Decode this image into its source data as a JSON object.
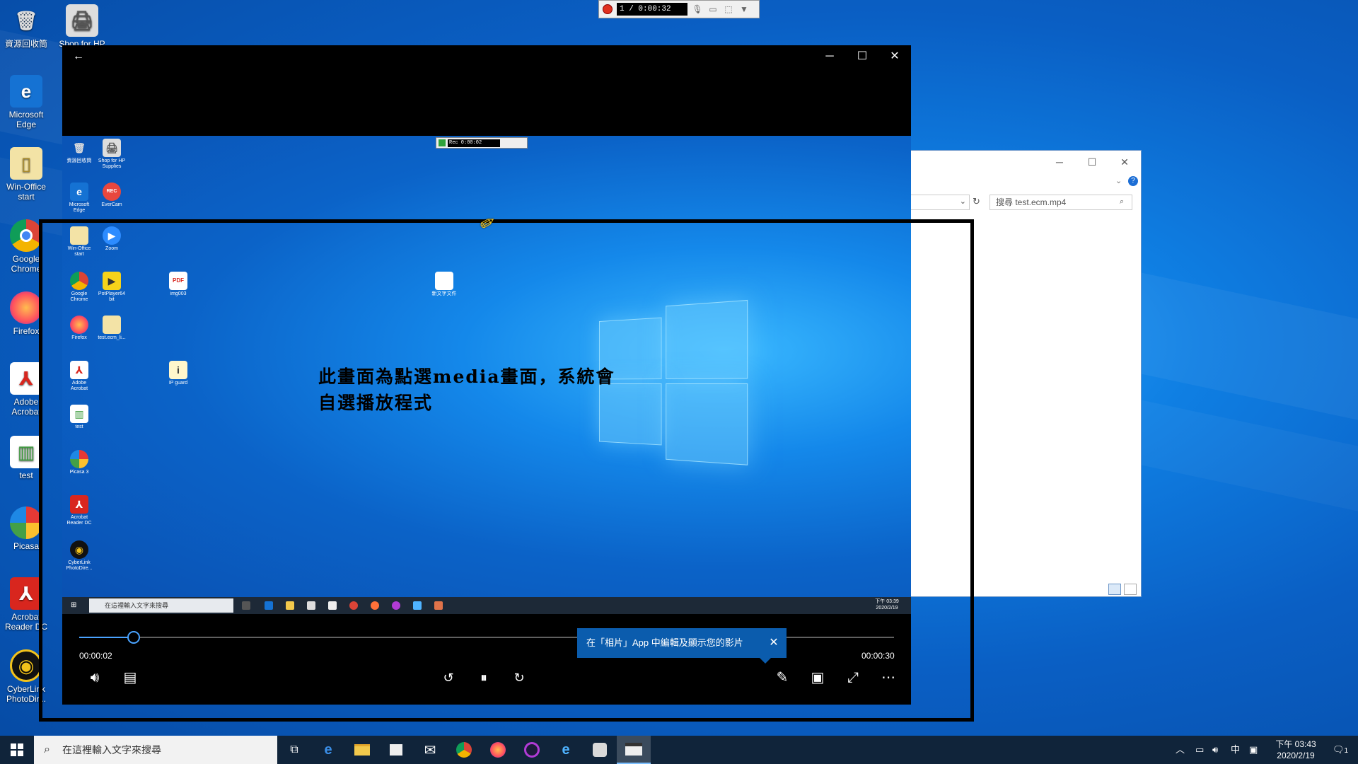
{
  "desktop": {
    "icons": [
      {
        "label": "資源回收筒",
        "icon": "recycle-bin-icon"
      },
      {
        "label": "Shop for HP",
        "icon": "printer-icon"
      },
      {
        "label": "Microsoft Edge",
        "icon": "edge-icon"
      },
      {
        "label": "Win-Office start",
        "icon": "folder-icon"
      },
      {
        "label": "Google Chrome",
        "icon": "chrome-icon"
      },
      {
        "label": "Firefox",
        "icon": "firefox-icon"
      },
      {
        "label": "Adobe Acrobat",
        "icon": "acrobat-icon"
      },
      {
        "label": "test",
        "icon": "test-icon"
      },
      {
        "label": "Picasa",
        "icon": "picasa-icon"
      },
      {
        "label": "Acrobat Reader DC",
        "icon": "reader-icon"
      },
      {
        "label": "CyberLink PhotoDir...",
        "icon": "cyberlink-icon"
      }
    ]
  },
  "recorder": {
    "timer": "1 / 0:00:32"
  },
  "explorer": {
    "search_placeholder": "搜尋 test.ecm.mp4"
  },
  "player": {
    "back_icon": "back-arrow-icon",
    "caption_line1": "此畫面為點選media畫面，系統會",
    "caption_line2": "自選播放程式",
    "current_time": "00:00:02",
    "total_time": "00:00:30",
    "progress": 0.067,
    "tooltip_text": "在「相片」App 中編輯及顯示您的影片",
    "inner_recorder_timer": "Rec 0:00:02",
    "inner_search": "在這裡輸入文字來搜尋",
    "inner_clock_time": "下午 03:39",
    "inner_clock_date": "2020/2/19",
    "inner_icons": [
      {
        "label": "資源回收筒"
      },
      {
        "label": "Shop for HP Supplies"
      },
      {
        "label": "Microsoft Edge"
      },
      {
        "label": "EverCam"
      },
      {
        "label": "Win-Office start"
      },
      {
        "label": "Zoom"
      },
      {
        "label": "Google Chrome"
      },
      {
        "label": "PotPlayer64 bit"
      },
      {
        "label": "img003"
      },
      {
        "label": "新文字文件"
      },
      {
        "label": "Firefox"
      },
      {
        "label": "test.ecm_li..."
      },
      {
        "label": "Adobe Acrobat"
      },
      {
        "label": "IP guard"
      },
      {
        "label": "test"
      },
      {
        "label": "Picasa 3"
      },
      {
        "label": "Acrobat Reader DC"
      },
      {
        "label": "CyberLink PhotoDire..."
      }
    ]
  },
  "taskbar": {
    "search_placeholder": "在這裡輸入文字來搜尋",
    "ime": "中",
    "clock_time": "下午 03:43",
    "clock_date": "2020/2/19",
    "notification_count": "1"
  },
  "colors": {
    "accent": "#4aa3ff",
    "tooltip": "#0b5cad",
    "taskbar": "#10243a"
  }
}
